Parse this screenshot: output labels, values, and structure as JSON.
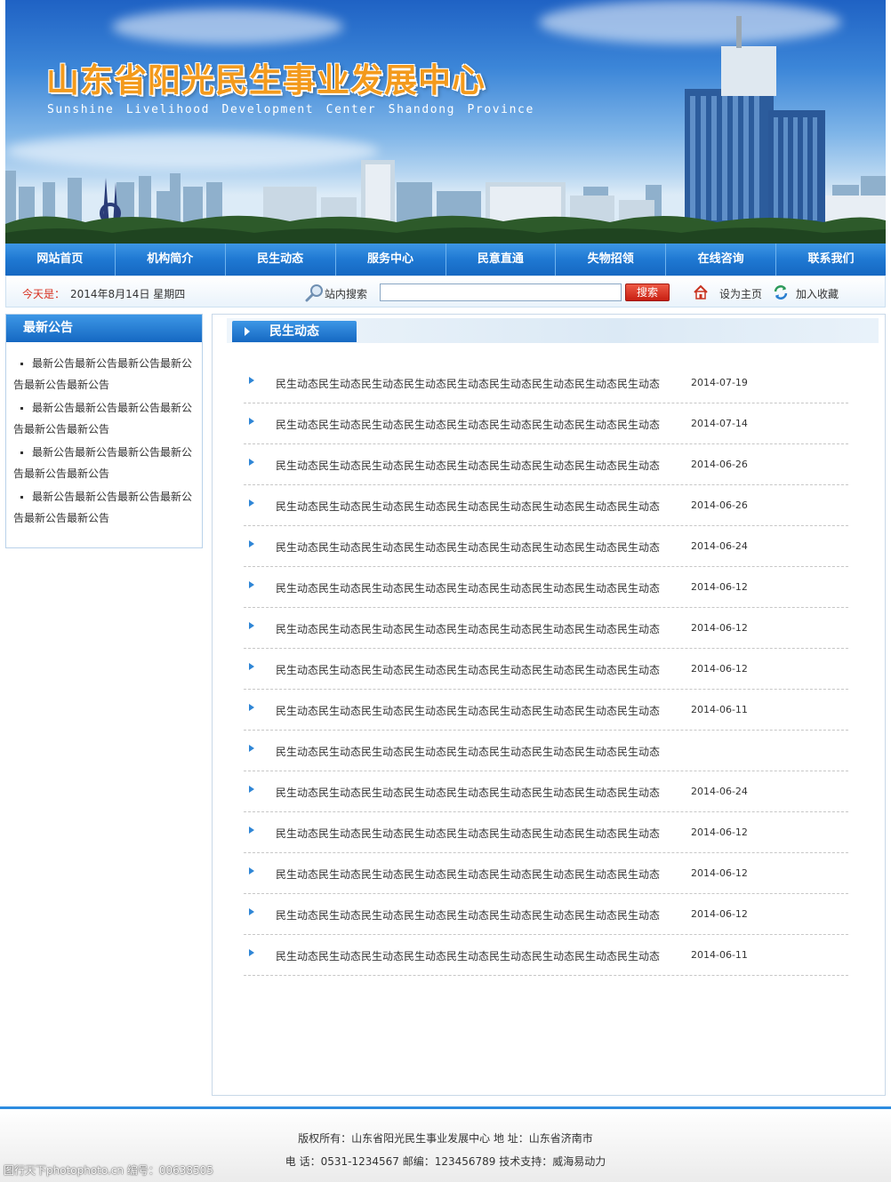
{
  "banner": {
    "title_cn": "山东省阳光民生事业发展中心",
    "title_en": "Sunshine Livelihood Development Center Shandong Province"
  },
  "nav": {
    "items": [
      {
        "label": "网站首页"
      },
      {
        "label": "机构简介"
      },
      {
        "label": "民生动态"
      },
      {
        "label": "服务中心"
      },
      {
        "label": "民意直通"
      },
      {
        "label": "失物招领"
      },
      {
        "label": "在线咨询"
      },
      {
        "label": "联系我们"
      }
    ]
  },
  "infobar": {
    "today_label": "今天是：",
    "today_value": "2014年8月14日 星期四",
    "search_label": "站内搜索",
    "search_value": "",
    "search_button": "搜索",
    "set_home": "设为主页",
    "add_favorite": "加入收藏"
  },
  "notice": {
    "title": "最新公告",
    "items": [
      "最新公告最新公告最新公告最新公告最新公告最新公告",
      "最新公告最新公告最新公告最新公告最新公告最新公告",
      "最新公告最新公告最新公告最新公告最新公告最新公告",
      "最新公告最新公告最新公告最新公告最新公告最新公告"
    ]
  },
  "main": {
    "tab_title": "民生动态",
    "news": [
      {
        "title": "民生动态民生动态民生动态民生动态民生动态民生动态民生动态民生动态民生动态",
        "date": "2014-07-19"
      },
      {
        "title": "民生动态民生动态民生动态民生动态民生动态民生动态民生动态民生动态民生动态",
        "date": "2014-07-14"
      },
      {
        "title": "民生动态民生动态民生动态民生动态民生动态民生动态民生动态民生动态民生动态",
        "date": "2014-06-26"
      },
      {
        "title": "民生动态民生动态民生动态民生动态民生动态民生动态民生动态民生动态民生动态",
        "date": "2014-06-26"
      },
      {
        "title": "民生动态民生动态民生动态民生动态民生动态民生动态民生动态民生动态民生动态",
        "date": "2014-06-24"
      },
      {
        "title": "民生动态民生动态民生动态民生动态民生动态民生动态民生动态民生动态民生动态",
        "date": "2014-06-12"
      },
      {
        "title": "民生动态民生动态民生动态民生动态民生动态民生动态民生动态民生动态民生动态",
        "date": "2014-06-12"
      },
      {
        "title": "民生动态民生动态民生动态民生动态民生动态民生动态民生动态民生动态民生动态",
        "date": "2014-06-12"
      },
      {
        "title": "民生动态民生动态民生动态民生动态民生动态民生动态民生动态民生动态民生动态",
        "date": "2014-06-11"
      },
      {
        "title": "民生动态民生动态民生动态民生动态民生动态民生动态民生动态民生动态民生动态",
        "date": ""
      },
      {
        "title": "民生动态民生动态民生动态民生动态民生动态民生动态民生动态民生动态民生动态",
        "date": "2014-06-24"
      },
      {
        "title": "民生动态民生动态民生动态民生动态民生动态民生动态民生动态民生动态民生动态",
        "date": "2014-06-12"
      },
      {
        "title": "民生动态民生动态民生动态民生动态民生动态民生动态民生动态民生动态民生动态",
        "date": "2014-06-12"
      },
      {
        "title": "民生动态民生动态民生动态民生动态民生动态民生动态民生动态民生动态民生动态",
        "date": "2014-06-12"
      },
      {
        "title": "民生动态民生动态民生动态民生动态民生动态民生动态民生动态民生动态民生动态",
        "date": "2014-06-11"
      }
    ]
  },
  "footer": {
    "line1": "版权所有：山东省阳光民生事业发展中心 地 址：山东省济南市",
    "line2": "电 话：0531-1234567   邮编：123456789   技术支持：威海易动力"
  },
  "watermark": "图行天下photophoto.cn   编号：00638505",
  "colors": {
    "nav_blue": "#1f78d2",
    "accent_red": "#d7301f",
    "title_orange": "#f39a1c",
    "footer_line": "#2d8ce0"
  }
}
